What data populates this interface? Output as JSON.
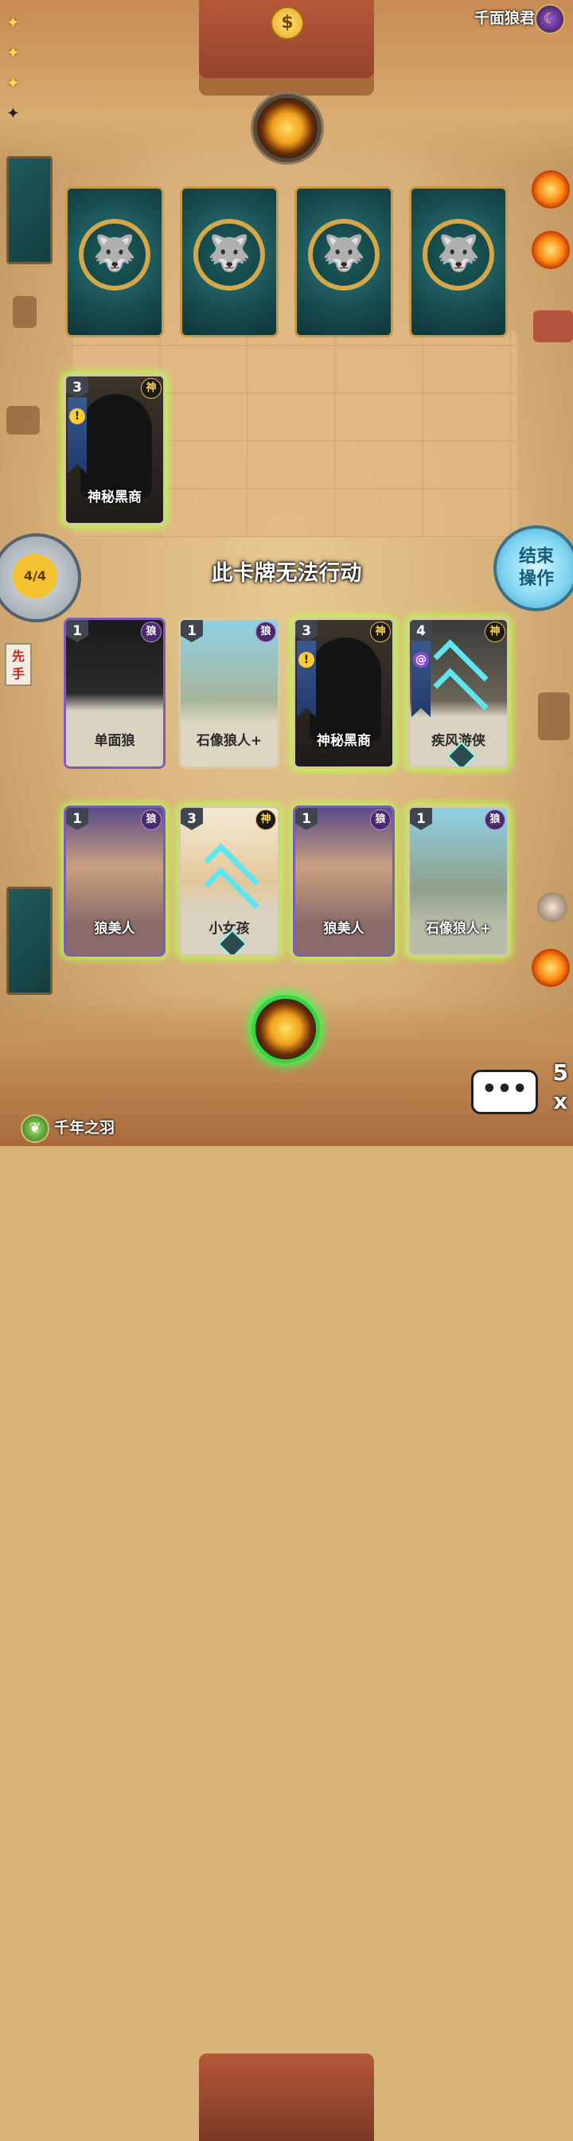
{
  "opponent": {
    "name": "千面狼君",
    "avatar_icon": "masked-wolf-icon"
  },
  "player": {
    "name": "千年之羽",
    "avatar_icon": "feather-icon"
  },
  "status_message": "此卡牌无法行动",
  "action_counter": "4/4",
  "end_turn_label": [
    "结束",
    "操作"
  ],
  "first_player_tag": [
    "先",
    "手"
  ],
  "speed": {
    "value": "5",
    "unit": "x"
  },
  "chat_label": "•••",
  "opponent_hand": [
    {
      "back_icon": "wolf-emblem-icon"
    },
    {
      "back_icon": "wolf-emblem-icon"
    },
    {
      "back_icon": "wolf-emblem-icon"
    },
    {
      "back_icon": "wolf-emblem-icon"
    }
  ],
  "opponent_field": [
    {
      "name": "神秘黑商",
      "cost": "3",
      "type": "神"
    }
  ],
  "player_field": [
    {
      "name": "单面狼",
      "cost": "1",
      "type": "狼"
    },
    {
      "name": "石像狼人+",
      "cost": "1",
      "type": "狼"
    },
    {
      "name": "神秘黑商",
      "cost": "3",
      "type": "神"
    },
    {
      "name": "疾风游侠",
      "cost": "4",
      "type": "神"
    }
  ],
  "player_hand": [
    {
      "name": "狼美人",
      "cost": "1",
      "type": "狼"
    },
    {
      "name": "小女孩",
      "cost": "3",
      "type": "神"
    },
    {
      "name": "狼美人",
      "cost": "1",
      "type": "狼"
    },
    {
      "name": "石像狼人+",
      "cost": "1",
      "type": "狼"
    }
  ],
  "colors": {
    "glow": "#b4ff4a",
    "active_orb": "#37d63f",
    "end_turn": "#7bd3f0"
  }
}
